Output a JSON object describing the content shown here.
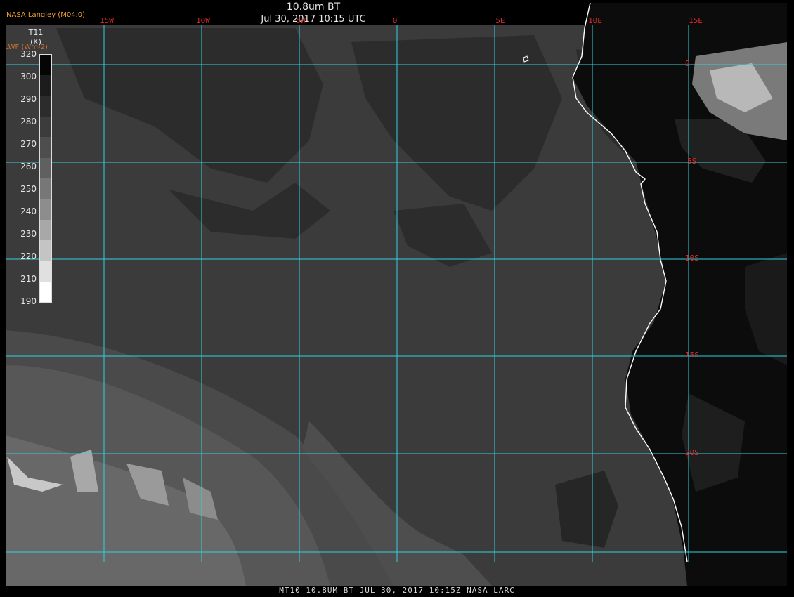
{
  "header": {
    "title": "10.8um BT",
    "datetime": "Jul 30, 2017 10:15 UTC",
    "brand": "NASA Langley (M04.0)"
  },
  "legend": {
    "title_line1": "T11",
    "title_line2": "(K)",
    "subtitle": "LWF (Wm-2)",
    "ticks": [
      "320",
      "300",
      "290",
      "280",
      "270",
      "260",
      "250",
      "240",
      "230",
      "220",
      "210",
      "190"
    ],
    "swatch_colors": [
      "#050505",
      "#1c1c1c",
      "#2c2c2c",
      "#3c3c3c",
      "#4e4e4e",
      "#606060",
      "#777777",
      "#8d8d8d",
      "#a8a8a8",
      "#c4c4c4",
      "#e0e0e0",
      "#ffffff"
    ]
  },
  "grid": {
    "color": "#30d0e0",
    "longitude_labels": [
      "15W",
      "10W",
      "5W",
      "0",
      "5E",
      "10E",
      "15E"
    ],
    "latitude_labels": [
      "0",
      "5S",
      "10S",
      "15S",
      "20S"
    ],
    "label_color": "#e02a2a"
  },
  "map": {
    "ocean_color": "#3b3b3b",
    "land_color": "#0c0c0c",
    "cloud_color": "#2a2a2a",
    "coastline_color": "#ffffff"
  },
  "footer": {
    "text": "MT10  10.8UM BT   JUL 30, 2017 10:15Z  NASA LARC"
  }
}
